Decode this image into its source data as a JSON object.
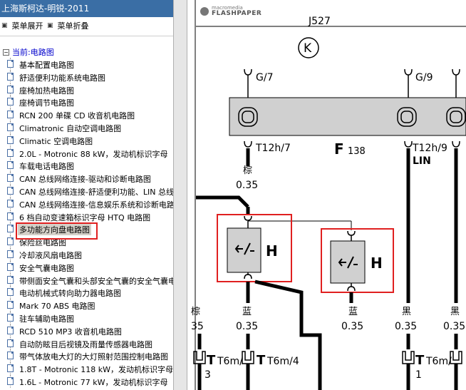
{
  "window": {
    "title": "上海斯柯达-明锐-2011"
  },
  "toolbar": {
    "expand_label": "菜单展开",
    "collapse_label": "菜单折叠"
  },
  "tree": {
    "current_label": "当前:电路图",
    "items": [
      "基本配置电路图",
      "舒适便利功能系统电路图",
      "座椅加热电路图",
      "座椅调节电路图",
      "RCN 200 单碟 CD 收音机电路图",
      "Climatronic 自动空调电路图",
      "Climatic 空调电路图",
      "2.0L - Motronic 88 kW，发动机标识字母",
      "车载电话电路图",
      "CAN 总线网络连接-驱动和诊断电路图",
      "CAN 总线网络连接-舒适便利功能、LIN 总线",
      "CAN 总线网络连接-信息娱乐系统和诊断电路",
      "6 档自动变速箱标识字母 HTQ 电路图",
      "多功能方向盘电路图",
      "保险丝电路图",
      "冷却液风扇电路图",
      "安全气囊电路图",
      "带侧面安全气囊和头部安全气囊的安全气囊电",
      "电动机械式转向助力器电路图",
      "Mark 70 ABS 电路图",
      "驻车辅助电路图",
      "RCD 510 MP3 收音机电路图",
      "自动防眩目后视镜及雨量传感器电路图",
      "带气体放电大灯的大灯照射范围控制电路图",
      "1.8T - Motronic 118 kW，发动机标识字母",
      "1.6L - Motronic 77 kW，发动机标识字母"
    ],
    "selected_index": 13
  },
  "viewer": {
    "logo_line1": "macromedia",
    "logo_line2": "FLASHPAPER",
    "top_partial_label": "J527",
    "ground_symbol": "K",
    "pin_g7": "G/7",
    "pin_g9": "G/9",
    "component_letter": "F",
    "component_number": "138",
    "t_left": "T12h/7",
    "t_right": "T12h/9",
    "lin_label": "LIN",
    "wire_brown": "棕",
    "wire_size_top": "0.35",
    "switch_label_1": "H",
    "switch_label_2": "H",
    "bottom_wires": [
      {
        "color": "棕",
        "size": "35"
      },
      {
        "color": "蓝",
        "size": "0.35"
      },
      {
        "color": "蓝",
        "size": "0.35"
      },
      {
        "color": "黑",
        "size": "0.35"
      },
      {
        "color": "黑",
        "size": "0.35"
      }
    ],
    "connector_1": "T6m/",
    "connector_1_num": "3",
    "connector_2": "T6m/4",
    "connector_3": "T6m/",
    "connector_3_num": "1"
  },
  "colors": {
    "title_bg": "#3a6ea5",
    "highlight": "#e02020",
    "link": "#0000cc"
  }
}
